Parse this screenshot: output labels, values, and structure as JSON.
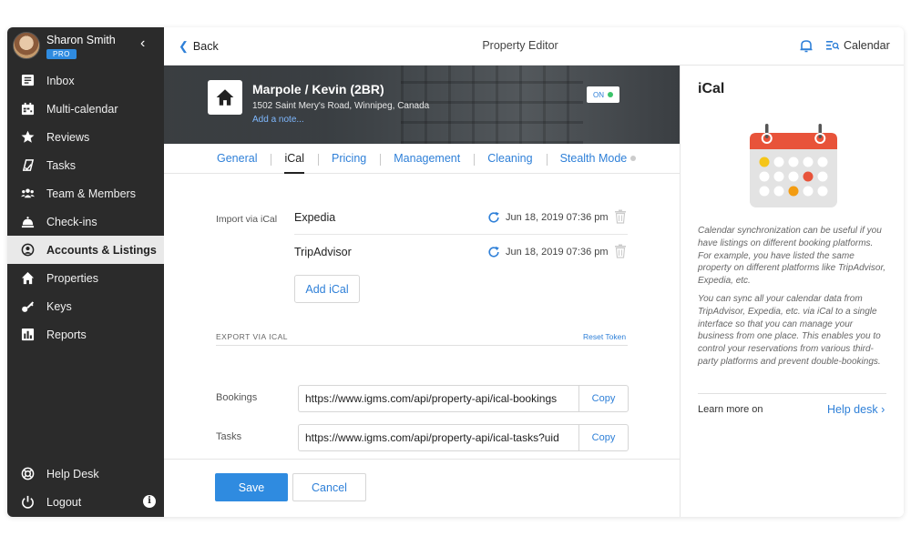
{
  "user": {
    "name": "Sharon Smith",
    "badge": "PRO"
  },
  "sidebar": {
    "items": [
      {
        "label": "Inbox",
        "icon": "inbox-icon"
      },
      {
        "label": "Multi-calendar",
        "icon": "calendar-icon"
      },
      {
        "label": "Reviews",
        "icon": "star-icon"
      },
      {
        "label": "Tasks",
        "icon": "tasks-icon"
      },
      {
        "label": "Team & Members",
        "icon": "team-icon"
      },
      {
        "label": "Check-ins",
        "icon": "bell-icon"
      },
      {
        "label": "Accounts & Listings",
        "icon": "account-icon",
        "active": true
      },
      {
        "label": "Properties",
        "icon": "home-icon"
      },
      {
        "label": "Keys",
        "icon": "key-icon"
      },
      {
        "label": "Reports",
        "icon": "reports-icon"
      }
    ],
    "bottom": [
      {
        "label": "Help Desk",
        "icon": "lifebuoy-icon"
      },
      {
        "label": "Logout",
        "icon": "power-icon"
      }
    ],
    "info_glyph": "i"
  },
  "header": {
    "back_label": "Back",
    "title": "Property Editor",
    "calendar_label": "Calendar"
  },
  "listing": {
    "title": "Marpole / Kevin (2BR)",
    "address": "1502 Saint Mery's Road, Winnipeg, Canada",
    "add_note": "Add a note...",
    "status": "ON"
  },
  "tabs": [
    {
      "label": "General"
    },
    {
      "label": "iCal",
      "active": true
    },
    {
      "label": "Pricing"
    },
    {
      "label": "Management"
    },
    {
      "label": "Cleaning"
    },
    {
      "label": "Stealth Mode"
    }
  ],
  "import": {
    "label": "Import via iCal",
    "rows": [
      {
        "source": "Expedia",
        "synced": "Jun 18, 2019 07:36 pm"
      },
      {
        "source": "TripAdvisor",
        "synced": "Jun 18, 2019 07:36 pm"
      }
    ],
    "add_label": "Add iCal"
  },
  "export": {
    "label": "EXPORT VIA ICAL",
    "reset_label": "Reset Token",
    "rows": [
      {
        "label": "Bookings",
        "url": "https://www.igms.com/api/property-api/ical-bookings",
        "copy": "Copy"
      },
      {
        "label": "Tasks",
        "url": "https://www.igms.com/api/property-api/ical-tasks?uid",
        "copy": "Copy"
      }
    ]
  },
  "footer": {
    "save": "Save",
    "cancel": "Cancel"
  },
  "panel": {
    "title": "iCal",
    "para1": "Calendar synchronization can be useful if you have listings on different booking platforms. For example, you have listed the same property on different platforms like TripAdvisor, Expedia, etc.",
    "para2": "You can sync all your calendar data from TripAdvisor, Expedia, etc. via iCal to a single interface so that you can manage your business from one place. This enables you to control your reservations from various third-party platforms and prevent double-bookings.",
    "learn_more": "Learn more on",
    "help_link": "Help desk"
  },
  "colors": {
    "accent": "#2f8be0",
    "sidebar_bg": "#2b2b2b",
    "toggle_on": "#3cc36a",
    "calendar_red": "#e8533a",
    "calendar_orange": "#f39c12",
    "calendar_yellow": "#f5c518"
  }
}
